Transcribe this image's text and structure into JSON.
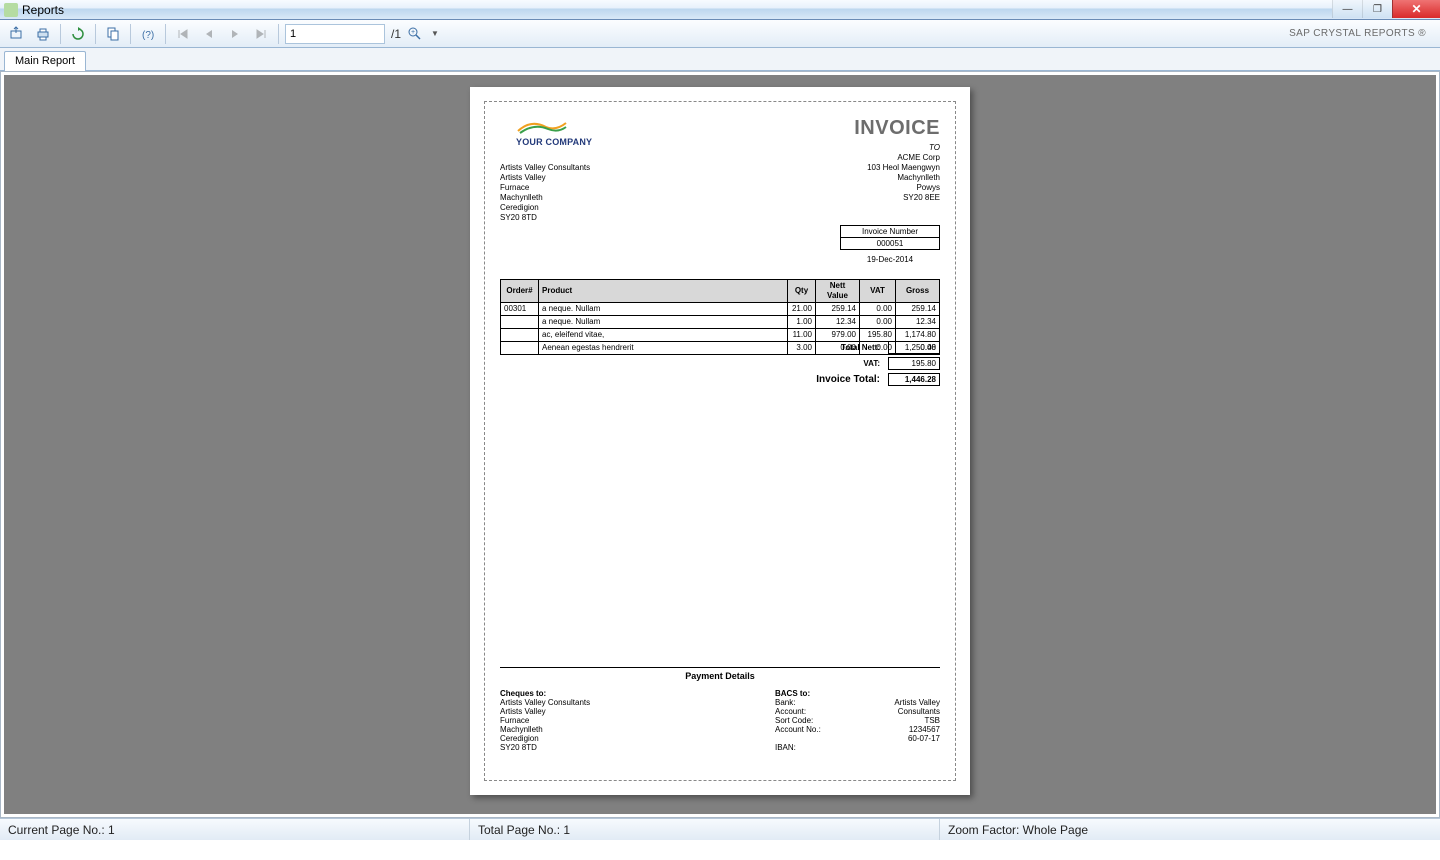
{
  "window": {
    "title": "Reports"
  },
  "toolbar": {
    "page_value": "1",
    "page_total": "/1",
    "brand": "SAP CRYSTAL REPORTS ®"
  },
  "tabs": {
    "main": "Main Report"
  },
  "invoice": {
    "title": "INVOICE",
    "logo_text": "YOUR COMPANY",
    "from": {
      "l1": "Artists Valley Consultants",
      "l2": "Artists Valley",
      "l3": "Furnace",
      "l4": "Machynlleth",
      "l5": "Ceredigion",
      "l6": "SY20 8TD"
    },
    "to_label": "TO",
    "to": {
      "l1": "ACME Corp",
      "l2": "103 Heol Maengwyn",
      "l3": "Machynlleth",
      "l4": "Powys",
      "l5": "SY20 8EE"
    },
    "invnum_label": "Invoice Number",
    "invnum_value": "000051",
    "date": "19-Dec-2014",
    "columns": {
      "order": "Order#",
      "product": "Product",
      "qty": "Qty",
      "nett": "Nett Value",
      "vat": "VAT",
      "gross": "Gross"
    },
    "lines": [
      {
        "order": "00301",
        "product": "a neque. Nullam",
        "qty": "21.00",
        "nett": "259.14",
        "vat": "0.00",
        "gross": "259.14"
      },
      {
        "order": "",
        "product": "a neque. Nullam",
        "qty": "1.00",
        "nett": "12.34",
        "vat": "0.00",
        "gross": "12.34"
      },
      {
        "order": "",
        "product": "ac, eleifend vitae,",
        "qty": "11.00",
        "nett": "979.00",
        "vat": "195.80",
        "gross": "1,174.80"
      },
      {
        "order": "",
        "product": "Aenean egestas hendrerit",
        "qty": "3.00",
        "nett": "0.00",
        "vat": "0.00",
        "gross": "0.00"
      }
    ],
    "totals": {
      "nett_label": "Total Nett:",
      "nett_value": "1,250.48",
      "vat_label": "VAT:",
      "vat_value": "195.80",
      "total_label": "Invoice Total:",
      "total_value": "1,446.28"
    },
    "payment": {
      "title": "Payment Details",
      "cheques_label": "Cheques to:",
      "cheques": {
        "l1": "Artists Valley Consultants",
        "l2": "Artists Valley",
        "l3": "Furnace",
        "l4": "Machynlleth",
        "l5": "Ceredigion",
        "l6": "SY20 8TD"
      },
      "bacs_label": "BACS to:",
      "bacs": {
        "bank_k": "Bank:",
        "bank_v": "Artists Valley",
        "acct_k": "Account:",
        "acct_v": "Consultants",
        "sort_k": "Sort Code:",
        "sort_v": "TSB",
        "acctno_k": "Account No.:",
        "acctno_v": "1234567",
        "blank_k": "",
        "blank_v": "60-07-17",
        "iban_k": "IBAN:",
        "iban_v": ""
      }
    }
  },
  "status": {
    "current": "Current Page No.: 1",
    "total": "Total Page No.: 1",
    "zoom": "Zoom Factor: Whole Page"
  }
}
